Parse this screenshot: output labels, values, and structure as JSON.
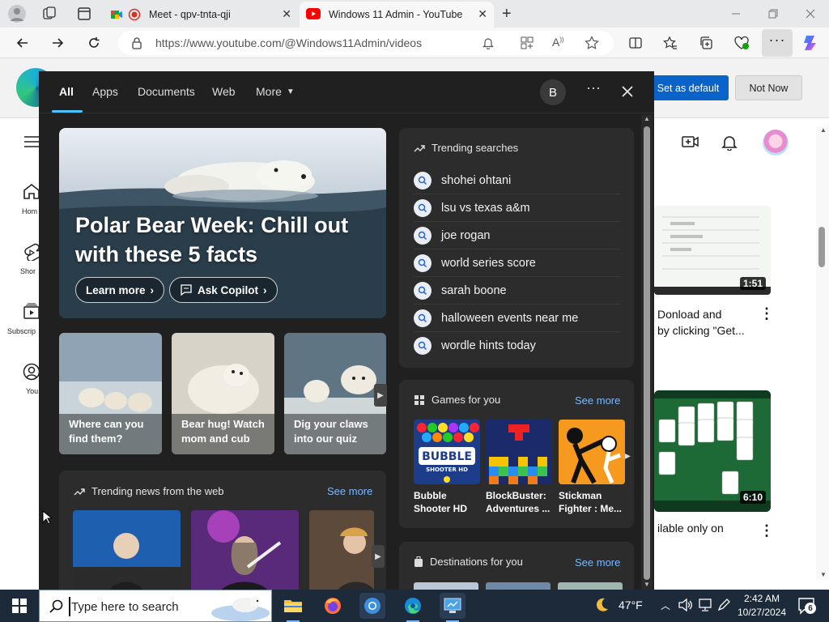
{
  "browser": {
    "tabs": [
      {
        "title": "Meet - qpv-tnta-qji"
      },
      {
        "title": "Windows 11 Admin - YouTube"
      }
    ],
    "url": "https://www.youtube.com/@Windows11Admin/videos"
  },
  "page": {
    "set_default_label": "Set as default",
    "not_now_label": "Not Now",
    "sidebar": [
      {
        "label": "Hom",
        "icon": "home-icon"
      },
      {
        "label": "Shor",
        "icon": "shorts-icon"
      },
      {
        "label": "Subscrip",
        "icon": "subscriptions-icon"
      },
      {
        "label": "You",
        "icon": "you-icon"
      }
    ],
    "videos": [
      {
        "duration": "1:51",
        "title_line1": "Donload and",
        "title_line2": "by clicking \"Get..."
      },
      {
        "duration": "6:10",
        "title_line1": "ilable only on",
        "title_line2": ""
      }
    ]
  },
  "flyout": {
    "tabs": [
      "All",
      "Apps",
      "Documents",
      "Web",
      "More"
    ],
    "avatar_letter": "B",
    "hero": {
      "title": "Polar Bear Week: Chill out with these 5 facts",
      "learn_more": "Learn more",
      "ask_copilot": "Ask Copilot"
    },
    "sub_cards": [
      {
        "caption": "Where can you find them?"
      },
      {
        "caption": "Bear hug! Watch mom and cub"
      },
      {
        "caption": "Dig your claws into our quiz"
      }
    ],
    "trending_title": "Trending searches",
    "trending": [
      "shohei ohtani",
      "lsu vs texas a&m",
      "joe rogan",
      "world series score",
      "sarah boone",
      "halloween events near me",
      "wordle hints today"
    ],
    "games_title": "Games for you",
    "see_more": "See more",
    "games": [
      {
        "name": "Bubble Shooter HD"
      },
      {
        "name": "BlockBuster: Adventures ..."
      },
      {
        "name": "Stickman Fighter : Me..."
      }
    ],
    "news_title": "Trending news from the web",
    "destinations_title": "Destinations for you"
  },
  "taskbar": {
    "search_placeholder": "Type here to search",
    "weather": "47°F",
    "time": "2:42 AM",
    "date": "10/27/2024",
    "notifications": "6"
  }
}
